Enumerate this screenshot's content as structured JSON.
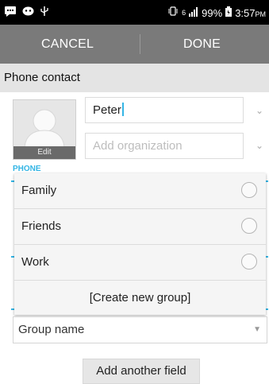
{
  "status_bar": {
    "network": "6",
    "battery": "99%",
    "time": "3:57",
    "ampm": "PM",
    "icons": [
      "chat-icon",
      "bbm-icon",
      "usb-icon",
      "vibrate-icon",
      "signal-icon",
      "battery-icon"
    ]
  },
  "action_bar": {
    "cancel_label": "CANCEL",
    "done_label": "DONE"
  },
  "header": {
    "title": "Phone contact"
  },
  "contact": {
    "edit_label": "Edit",
    "name_value": "Peter",
    "organization_placeholder": "Add organization"
  },
  "section": {
    "phone_label": "PHONE"
  },
  "group_popup": {
    "options": [
      {
        "label": "Family",
        "checked": false
      },
      {
        "label": "Friends",
        "checked": false
      },
      {
        "label": "Work",
        "checked": false
      }
    ],
    "create_label": "[Create new group]"
  },
  "group_spinner": {
    "placeholder": "Group name"
  },
  "add_field_label": "Add another field",
  "colors": {
    "accent": "#33b5e5",
    "action_bar": "#7a7a7a",
    "header_bg": "#e4e4e4"
  }
}
